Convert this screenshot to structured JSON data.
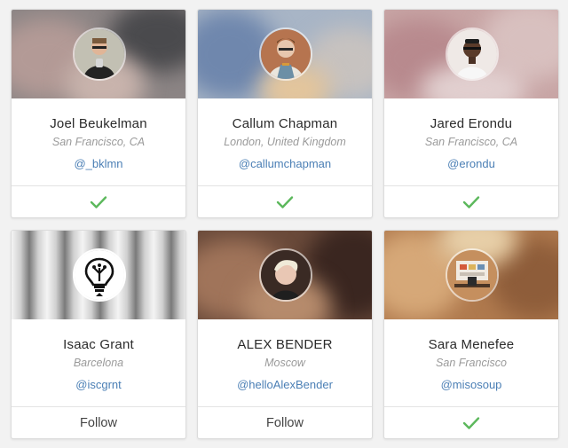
{
  "cards": [
    {
      "name": "Joel Beukelman",
      "location": "San Francisco, CA",
      "handle": "@_bklmn",
      "status": "following"
    },
    {
      "name": "Callum Chapman",
      "location": "London, United Kingdom",
      "handle": "@callumchapman",
      "status": "following"
    },
    {
      "name": "Jared Erondu",
      "location": "San Francisco, CA",
      "handle": "@erondu",
      "status": "following"
    },
    {
      "name": "Isaac Grant",
      "location": "Barcelona",
      "handle": "@iscgrnt",
      "status": "follow",
      "action_label": "Follow"
    },
    {
      "name": "ALEX BENDER",
      "location": "Moscow",
      "handle": "@helloAlexBender",
      "status": "follow",
      "action_label": "Follow"
    },
    {
      "name": "Sara Menefee",
      "location": "San Francisco",
      "handle": "@misosoup",
      "status": "following"
    }
  ],
  "icons": {
    "following": "checkmark-icon"
  },
  "colors": {
    "accent_check": "#5cb85c",
    "handle_link": "#4b7fb5"
  }
}
